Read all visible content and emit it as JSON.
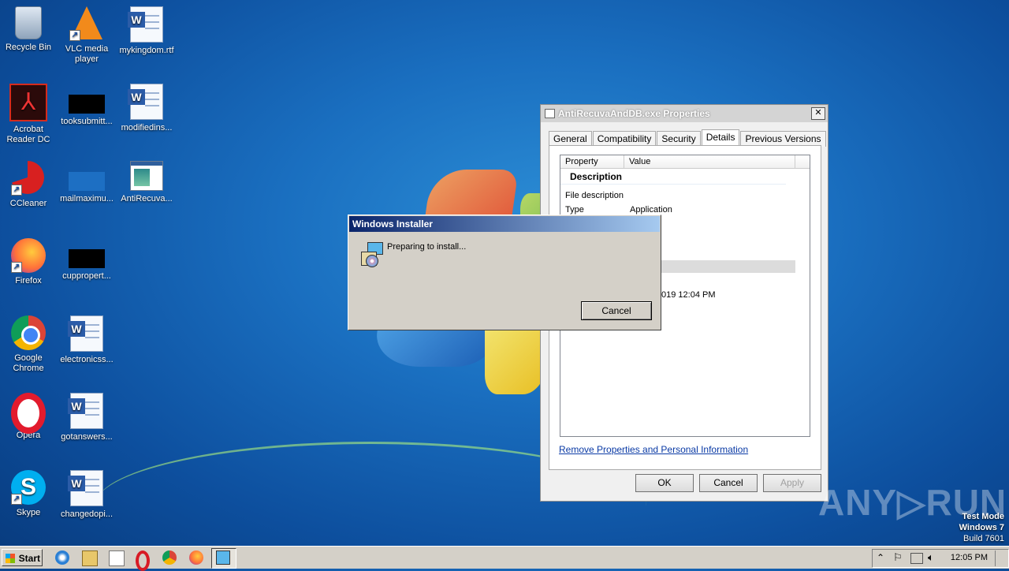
{
  "desktop": {
    "icons": [
      {
        "label": "Recycle Bin"
      },
      {
        "label": "VLC media player"
      },
      {
        "label": "mykingdom.rtf"
      },
      {
        "label": "Acrobat Reader DC"
      },
      {
        "label": "tooksubmitt..."
      },
      {
        "label": "modifiedins..."
      },
      {
        "label": "CCleaner"
      },
      {
        "label": "mailmaximu..."
      },
      {
        "label": "AntiRecuva..."
      },
      {
        "label": "Firefox"
      },
      {
        "label": "cuppropert..."
      },
      {
        "label": "Google Chrome"
      },
      {
        "label": "electronicss..."
      },
      {
        "label": "Opera"
      },
      {
        "label": "gotanswers..."
      },
      {
        "label": "Skype"
      },
      {
        "label": "changedopi..."
      }
    ]
  },
  "properties": {
    "title": "AntiRecuvaAndDB.exe Properties",
    "close": "✕",
    "tabs": [
      "General",
      "Compatibility",
      "Security",
      "Details",
      "Previous Versions"
    ],
    "columns": [
      "Property",
      "Value"
    ],
    "group": "Description",
    "rows": [
      {
        "key": "File description",
        "value": ""
      },
      {
        "key": "Type",
        "value": "Application"
      }
    ],
    "date_fragment": "019 12:04 PM",
    "remove_link": "Remove Properties and Personal Information",
    "buttons": {
      "ok": "OK",
      "cancel": "Cancel",
      "apply": "Apply"
    }
  },
  "installer": {
    "title": "Windows Installer",
    "message": "Preparing to install...",
    "cancel": "Cancel"
  },
  "watermark": "ANY▷RUN",
  "test_mode": {
    "line1": "Test Mode",
    "line2": "Windows 7",
    "line3": "Build 7601"
  },
  "taskbar": {
    "start": "Start",
    "clock": "12:05 PM"
  },
  "colors": {
    "titlebar_active": "#0a246a",
    "link": "#0a3aa5"
  }
}
